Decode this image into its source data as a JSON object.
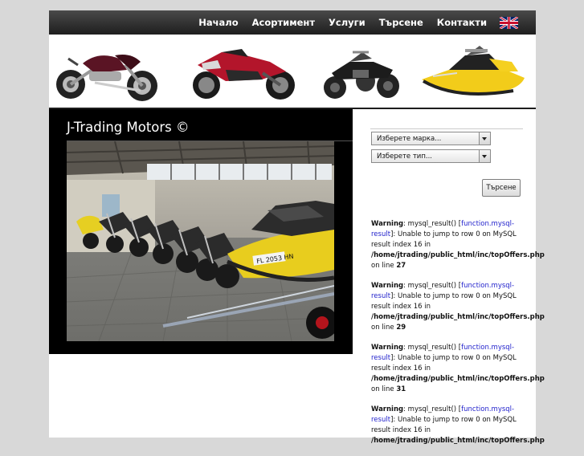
{
  "nav": {
    "items": [
      "Начало",
      "Асортимент",
      "Услуги",
      "Търсене",
      "Контакти"
    ],
    "language_flag": "uk-flag-icon"
  },
  "banner": {
    "images": [
      "cruiser-motorcycle",
      "sport-motorcycle",
      "atv-quad",
      "jet-ski"
    ]
  },
  "hero": {
    "title": "J-Trading Motors ©",
    "photo": "showroom-motorcycles-jetski-photo"
  },
  "search": {
    "brand_select": "Изберете марка...",
    "type_select": "Изберете тип...",
    "button": "Търсене"
  },
  "warnings": [
    {
      "label": "Warning",
      "pre": ": mysql_result() [",
      "link": "function.mysql-result",
      "msg": "]: Unable to jump to row 0 on MySQL result index 16 in ",
      "path": "/home/jtrading/public_html/inc/topOffers.php",
      "on": " on line ",
      "line": "27"
    },
    {
      "label": "Warning",
      "pre": ": mysql_result() [",
      "link": "function.mysql-result",
      "msg": "]: Unable to jump to row 0 on MySQL result index 16 in ",
      "path": "/home/jtrading/public_html/inc/topOffers.php",
      "on": " on line ",
      "line": "29"
    },
    {
      "label": "Warning",
      "pre": ": mysql_result() [",
      "link": "function.mysql-result",
      "msg": "]: Unable to jump to row 0 on MySQL result index 16 in ",
      "path": "/home/jtrading/public_html/inc/topOffers.php",
      "on": " on line ",
      "line": "31"
    },
    {
      "label": "Warning",
      "pre": ": mysql_result() [",
      "link": "function.mysql-result",
      "msg": "]: Unable to jump to row 0 on MySQL result index 16 in ",
      "path": "/home/jtrading/public_html/inc/topOffers.php",
      "on": "",
      "line": ""
    }
  ],
  "colors": {
    "navbar": "#2e2e2e",
    "page_background": "#d8d8d8",
    "link": "#2222cc"
  }
}
